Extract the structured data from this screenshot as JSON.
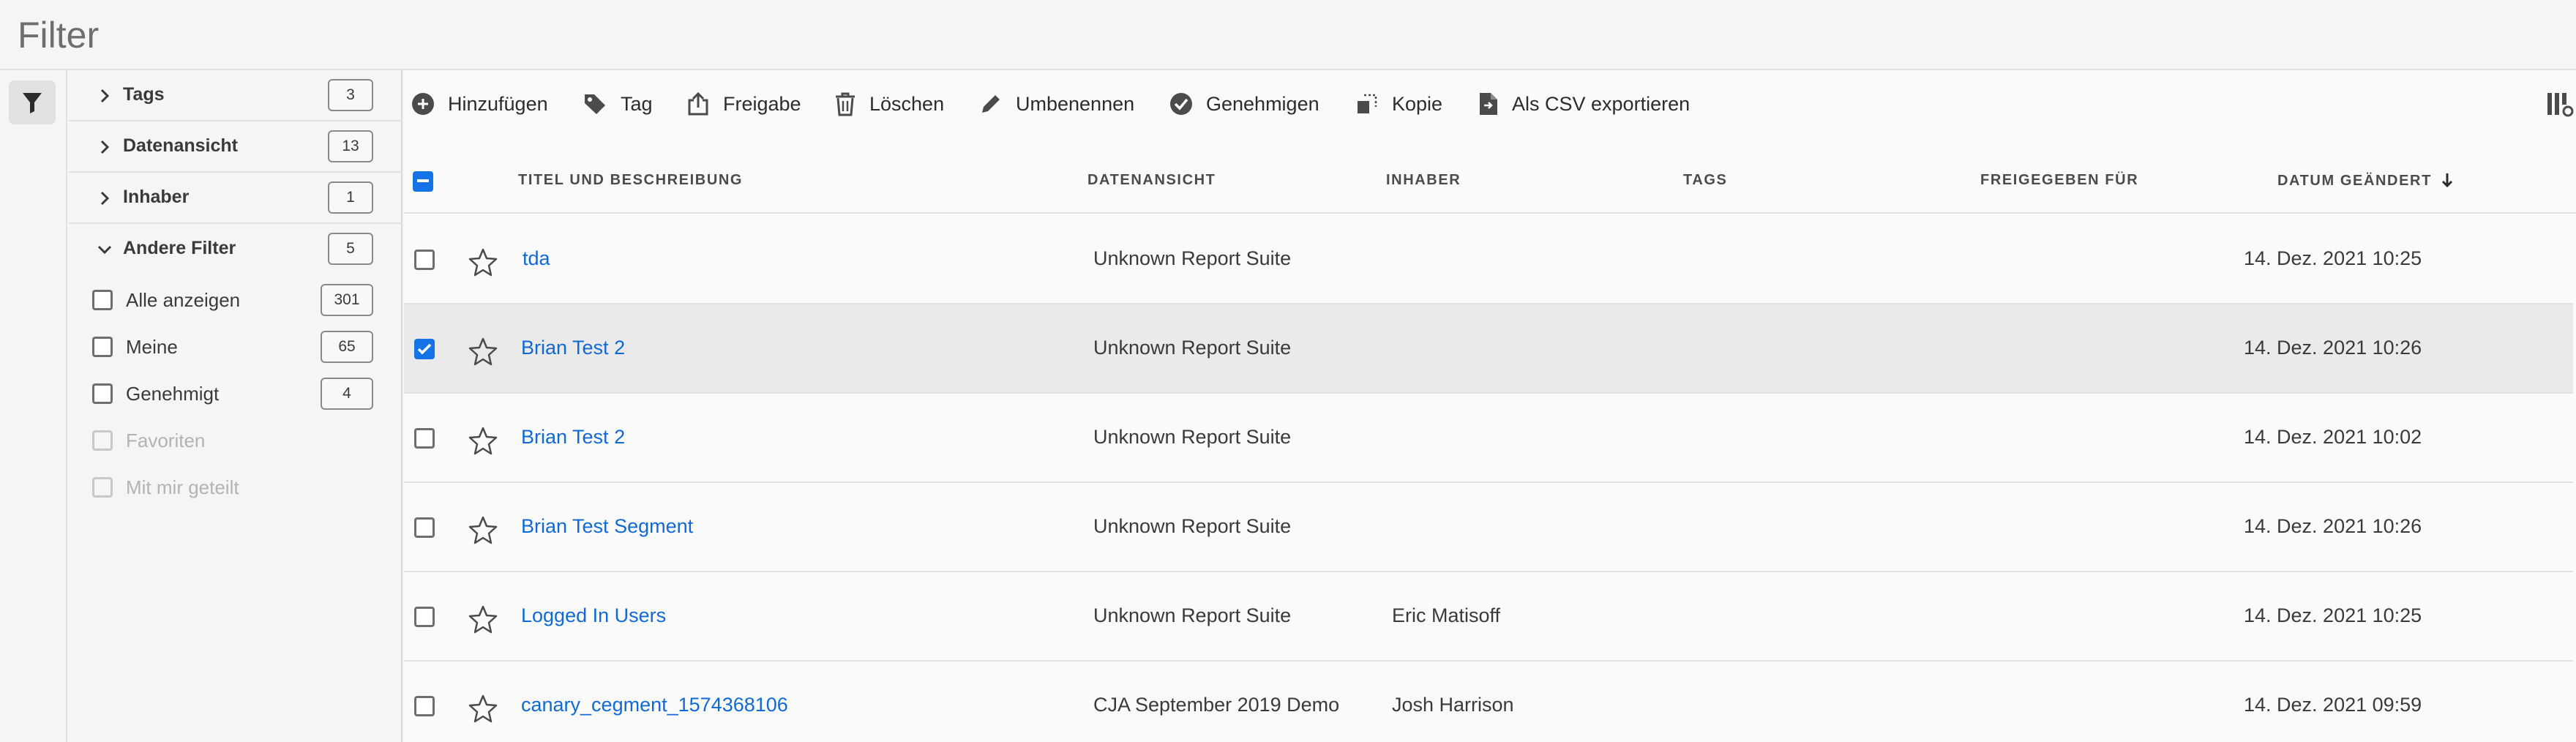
{
  "page": {
    "title": "Filter"
  },
  "colors": {
    "accent": "#1473e6",
    "link": "#1169d4"
  },
  "filters": {
    "groups": [
      {
        "label": "Tags",
        "count": "3"
      },
      {
        "label": "Datenansicht",
        "count": "13"
      },
      {
        "label": "Inhaber",
        "count": "1"
      },
      {
        "label": "Andere Filter",
        "count": "5"
      }
    ],
    "options": [
      {
        "label": "Alle anzeigen",
        "count": "301",
        "disabled": false
      },
      {
        "label": "Meine",
        "count": "65",
        "disabled": false
      },
      {
        "label": "Genehmigt",
        "count": "4",
        "disabled": false
      },
      {
        "label": "Favoriten",
        "disabled": true
      },
      {
        "label": "Mit mir geteilt",
        "disabled": true
      }
    ]
  },
  "toolbar": {
    "add": "Hinzufügen",
    "tag": "Tag",
    "share": "Freigabe",
    "delete": "Löschen",
    "rename": "Umbenennen",
    "approve": "Genehmigen",
    "copy": "Kopie",
    "export": "Als CSV exportieren"
  },
  "table": {
    "columns": {
      "title": "TITEL UND BESCHREIBUNG",
      "dataview": "DATENANSICHT",
      "owner": "INHABER",
      "tags": "TAGS",
      "shared": "FREIGEGEBEN FÜR",
      "modified": "DATUM GEÄNDERT"
    },
    "rows": [
      {
        "title": "tda",
        "dataview": "Unknown Report Suite",
        "owner": "",
        "tags": "",
        "shared": "",
        "modified": "14. Dez. 2021 10:25",
        "selected": false
      },
      {
        "title": "Brian Test 2",
        "dataview": "Unknown Report Suite",
        "owner": "",
        "tags": "",
        "shared": "",
        "modified": "14. Dez. 2021 10:26",
        "selected": true
      },
      {
        "title": "Brian Test 2",
        "dataview": "Unknown Report Suite",
        "owner": "",
        "tags": "",
        "shared": "",
        "modified": "14. Dez. 2021 10:02",
        "selected": false
      },
      {
        "title": "Brian Test Segment",
        "dataview": "Unknown Report Suite",
        "owner": "",
        "tags": "",
        "shared": "",
        "modified": "14. Dez. 2021 10:26",
        "selected": false
      },
      {
        "title": "Logged In Users",
        "dataview": "Unknown Report Suite",
        "owner": "Eric Matisoff",
        "tags": "",
        "shared": "",
        "modified": "14. Dez. 2021 10:25",
        "selected": false
      },
      {
        "title": "canary_cegment_1574368106",
        "dataview": "CJA September 2019 Demo",
        "owner": "Josh Harrison",
        "tags": "",
        "shared": "",
        "modified": "14. Dez. 2021 09:59",
        "selected": false
      }
    ]
  }
}
